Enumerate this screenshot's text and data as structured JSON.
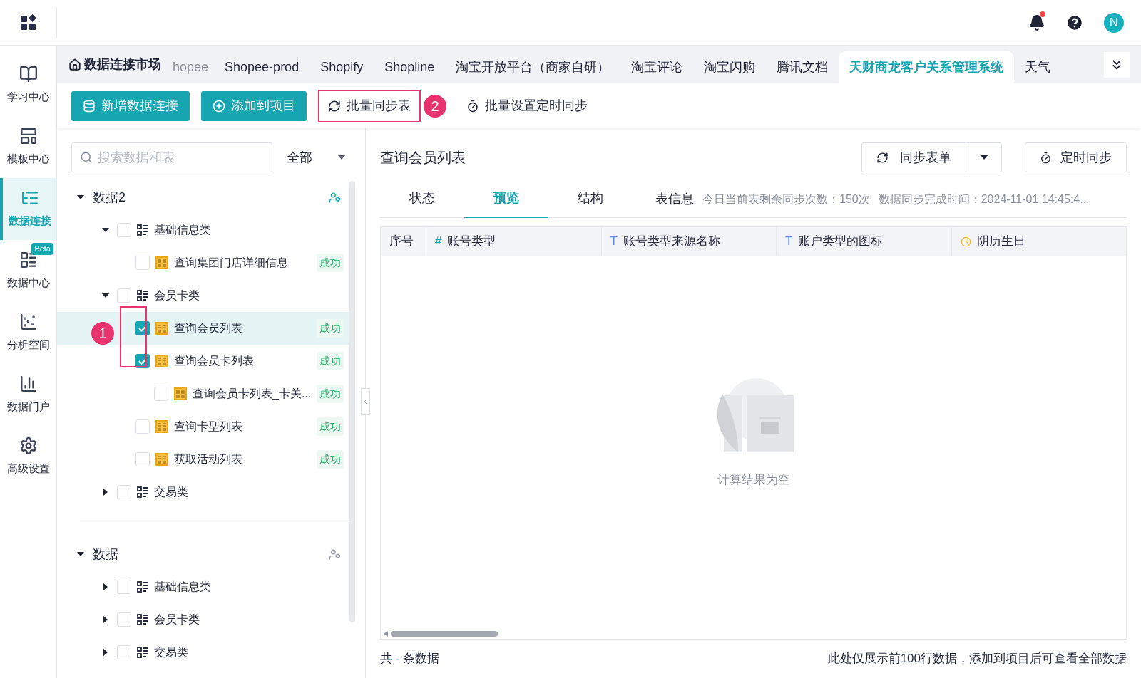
{
  "topbar": {
    "avatar": "N",
    "has_notification": true
  },
  "sidebar": {
    "items": [
      {
        "label": "学习中心",
        "selected": false
      },
      {
        "label": "模板中心",
        "selected": false
      },
      {
        "label": "数据连接",
        "selected": true
      },
      {
        "label": "数据中心",
        "selected": false,
        "badge": "Beta"
      },
      {
        "label": "分析空间",
        "selected": false
      },
      {
        "label": "数据门户",
        "selected": false
      },
      {
        "label": "高级设置",
        "selected": false
      }
    ]
  },
  "tabbar": {
    "home": "数据连接市场",
    "tabs": [
      {
        "label": "hopee",
        "selected": false,
        "clipped": true
      },
      {
        "label": "Shopee-prod",
        "selected": false,
        "clipped": false
      },
      {
        "label": "Shopify",
        "selected": false,
        "clipped": false
      },
      {
        "label": "Shopline",
        "selected": false,
        "clipped": false
      },
      {
        "label": "淘宝开放平台（商家自研）",
        "selected": false,
        "clipped": false
      },
      {
        "label": "淘宝评论",
        "selected": false,
        "clipped": false
      },
      {
        "label": "淘宝闪购",
        "selected": false,
        "clipped": false
      },
      {
        "label": "腾讯文档",
        "selected": false,
        "clipped": false
      },
      {
        "label": "天财商龙客户关系管理系统",
        "selected": true,
        "clipped": false
      },
      {
        "label": "天气",
        "selected": false,
        "clipped": false
      }
    ]
  },
  "toolbar": {
    "buttons": [
      {
        "label": "新增数据连接",
        "kind": "primary"
      },
      {
        "label": "添加到项目",
        "kind": "primary"
      },
      {
        "label": "批量同步表",
        "kind": "plain",
        "highlighted": true,
        "annotation": "2"
      },
      {
        "label": "批量设置定时同步",
        "kind": "plain",
        "highlighted": false
      }
    ]
  },
  "tree": {
    "search": {
      "placeholder": "搜索数据和表"
    },
    "filter": "全部",
    "groups": [
      {
        "name": "数据2",
        "expanded": true,
        "shared": true,
        "children": [
          {
            "name": "基础信息类",
            "kind": "folder",
            "expanded": true,
            "checked": false,
            "children": [
              {
                "name": "查询集团门店详细信息",
                "kind": "table",
                "status": "成功",
                "checked": false,
                "selected": false
              }
            ]
          },
          {
            "name": "会员卡类",
            "kind": "folder",
            "expanded": true,
            "checked": false,
            "children": [
              {
                "name": "查询会员列表",
                "kind": "table",
                "status": "成功",
                "checked": true,
                "selected": true
              },
              {
                "name": "查询会员卡列表",
                "kind": "table",
                "status": "成功",
                "checked": true,
                "selected": false,
                "children": [
                  {
                    "name": "查询会员卡列表_卡关...",
                    "kind": "table",
                    "status": "成功",
                    "checked": false,
                    "selected": false
                  }
                ]
              },
              {
                "name": "查询卡型列表",
                "kind": "table",
                "status": "成功",
                "checked": false,
                "selected": false
              },
              {
                "name": "获取活动列表",
                "kind": "table",
                "status": "成功",
                "checked": false,
                "selected": false
              }
            ]
          },
          {
            "name": "交易类",
            "kind": "folder",
            "expanded": false,
            "checked": false
          }
        ]
      },
      {
        "name": "数据",
        "expanded": true,
        "shared": false,
        "children": [
          {
            "name": "基础信息类",
            "kind": "folder",
            "expanded": false,
            "checked": false
          },
          {
            "name": "会员卡类",
            "kind": "folder",
            "expanded": false,
            "checked": false
          },
          {
            "name": "交易类",
            "kind": "folder",
            "expanded": false,
            "checked": false
          }
        ]
      }
    ],
    "annotation": "1"
  },
  "detail": {
    "title": "查询会员列表",
    "sync_button": "同步表单",
    "timer_button": "定时同步",
    "tabs": [
      {
        "label": "状态",
        "selected": false
      },
      {
        "label": "预览",
        "selected": true
      },
      {
        "label": "结构",
        "selected": false
      }
    ],
    "info_label": "表信息",
    "info": [
      "今日当前表剩余同步次数：150次",
      "数据同步完成时间：2024-11-01 14:45:4..."
    ],
    "columns": [
      {
        "label": "序号",
        "kind": "plain"
      },
      {
        "label": "账号类型",
        "kind": "number",
        "glyph": "#"
      },
      {
        "label": "账号类型来源名称",
        "kind": "text",
        "glyph": "T"
      },
      {
        "label": "账户类型的图标",
        "kind": "text",
        "glyph": "T"
      },
      {
        "label": "阴历生日",
        "kind": "date"
      }
    ],
    "empty": "计算结果为空",
    "footer_prefix": "共",
    "footer_count": "-",
    "footer_suffix": "条数据",
    "footer_note": "此处仅展示前100行数据，添加到项目后可查看全部数据"
  }
}
